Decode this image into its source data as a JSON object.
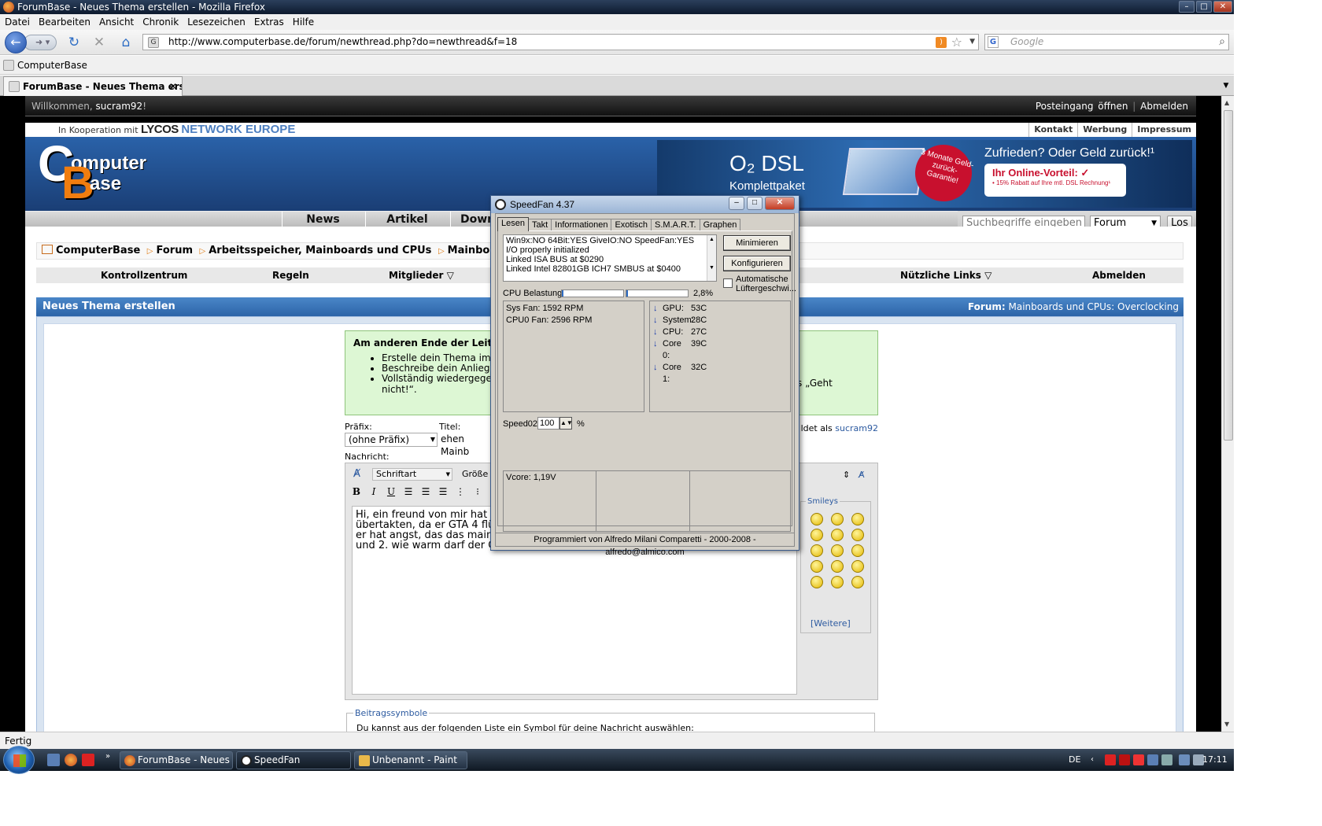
{
  "window": {
    "title": "ForumBase - Neues Thema erstellen - Mozilla Firefox"
  },
  "menu": [
    "Datei",
    "Bearbeiten",
    "Ansicht",
    "Chronik",
    "Lesezeichen",
    "Extras",
    "Hilfe"
  ],
  "nav": {
    "url": "http://www.computerbase.de/forum/newthread.php?do=newthread&f=18",
    "search_placeholder": "Google"
  },
  "bookmarks": {
    "item": "ComputerBase"
  },
  "tab": {
    "title": "ForumBase - Neues Thema erstell..."
  },
  "site": {
    "welcome_prefix": "Willkommen,",
    "username": "sucram92",
    "welcome_suffix": "!",
    "inbox": "Posteingang öffnen",
    "logout": "Abmelden",
    "coop_text": "In Kooperation mit",
    "coop_lycos": "LYCOS",
    "coop_network": "NETWORK EUROPE",
    "top_links": [
      "Kontakt",
      "Werbung",
      "Impressum"
    ],
    "logo_line1": "omputer",
    "logo_line2": "ase",
    "ad": {
      "title": "O₂ DSL",
      "subtitle": "Komplettpaket",
      "badge": "3 Monate Geld-zurück-Garantie!",
      "headline": "Zufrieden? Oder Geld zurück!¹",
      "offer": "Ihr Online-Vorteil: ✓",
      "offer_small": "• 15% Rabatt auf Ihre mtl. DSL Rechnung¹"
    },
    "main_nav": [
      "News",
      "Artikel",
      "Down"
    ],
    "search_placeholder": "Suchbegriffe eingeben",
    "search_scope": "Forum",
    "search_button": "Los",
    "breadcrumb": [
      "ComputerBase",
      "Forum",
      "Arbeitsspeicher, Mainboards und CPUs",
      "Mainboards und CPUs:"
    ],
    "user_nav": [
      "Kontrollzentrum",
      "Regeln",
      "Mitglieder ▽",
      "Nützliche Links ▽",
      "Abmelden"
    ],
    "thread_title": "Neues Thema erstellen",
    "forum_label": "Forum:",
    "forum_name": "Mainboards und CPUs: Overclocking",
    "info_title": "Am anderen Ende der Leitun",
    "info_items": [
      "Erstelle dein Thema im",
      "Beschreibe dein Anliege",
      "Vollständig wiedergege"
    ],
    "info_right": "s „Geht",
    "info_tail": "nicht!“.",
    "prefix_label": "Präfix:",
    "prefix_value": "(ohne Präfix)",
    "title_label": "Titel:",
    "title_value": "ehen Mainb",
    "logged_label": "ldet als",
    "message_label": "Nachricht:",
    "font_select": "Schriftart",
    "size_label": "Größe",
    "message_text": "Hi, ein freund von mir hat eine\nübertakten, da er GTA 4 flüss\ner hat angst, das das mainbo\nund 2. wie warm darf der Chi",
    "smileys_legend": "Smileys",
    "smileys_more": "[Weitere]",
    "symbols_legend": "Beitragssymbole",
    "symbols_text": "Du kannst aus der folgenden Liste ein Symbol für deine Nachricht auswählen:"
  },
  "speedfan": {
    "title": "SpeedFan 4.37",
    "tabs": [
      "Lesen",
      "Takt",
      "Informationen",
      "Exotisch",
      "S.M.A.R.T.",
      "Graphen"
    ],
    "log": [
      "Win9x:NO  64Bit:YES  GiveIO:NO  SpeedFan:YES",
      "I/O properly initialized",
      "Linked ISA BUS at $0290",
      "Linked Intel 82801GB ICH7 SMBUS at $0400"
    ],
    "btn_minimize": "Minimieren",
    "btn_configure": "Konfigurieren",
    "auto_fan": "Automatische Lüftergeschwi...",
    "cpu_label": "CPU Belastung",
    "cpu_value": "2,8%",
    "cpu_load_fraction": 0.028,
    "fans": [
      "Sys Fan:    1592 RPM",
      "CPU0 Fan: 2596 RPM"
    ],
    "temps": [
      {
        "name": "GPU:",
        "value": "53C"
      },
      {
        "name": "System:",
        "value": "28C"
      },
      {
        "name": "CPU:",
        "value": "27C"
      },
      {
        "name": "Core 0:",
        "value": "39C"
      },
      {
        "name": "Core 1:",
        "value": "32C"
      }
    ],
    "speed_label": "Speed02:",
    "speed_value": "100",
    "speed_unit": "%",
    "vcore": "Vcore:    1,19V",
    "footer": "Programmiert von Alfredo Milani Comparetti - 2000-2008 - alfredo@almico.com"
  },
  "status": {
    "text": "Fertig"
  },
  "taskbar": {
    "items": [
      "ForumBase - Neues ...",
      "SpeedFan",
      "Unbenannt - Paint"
    ],
    "lang": "DE",
    "clock": "17:11"
  },
  "colors": {
    "accent": "#2c64a8",
    "ad_red": "#c8102e",
    "logo_orange": "#f07d0f"
  }
}
